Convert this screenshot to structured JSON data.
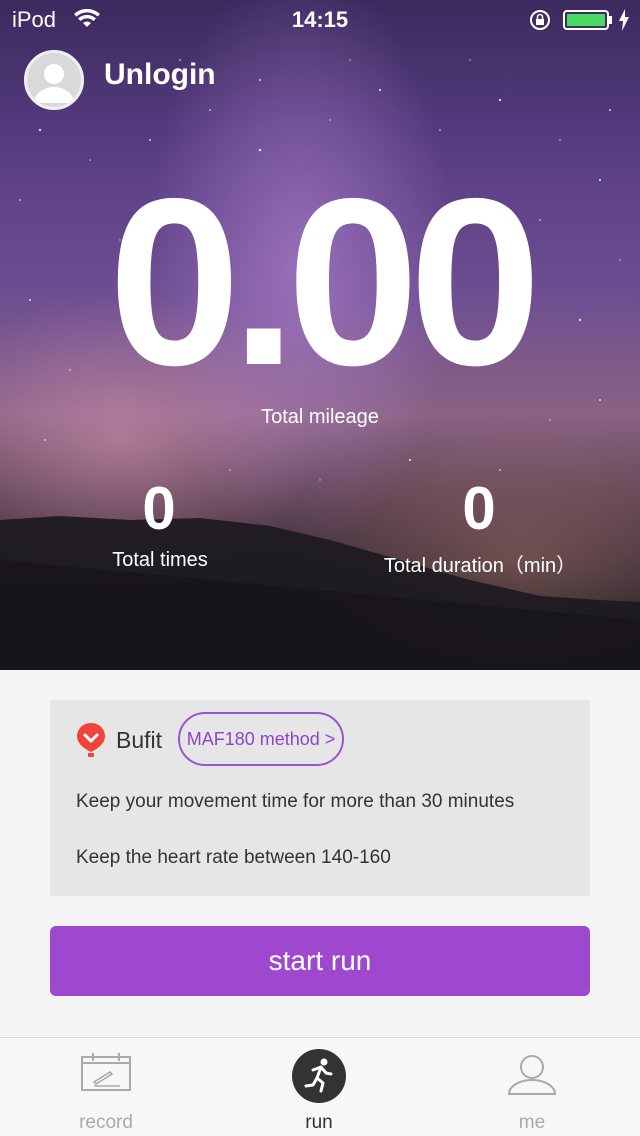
{
  "status_bar": {
    "carrier": "iPod",
    "time": "14:15",
    "icons": [
      "wifi-icon",
      "lock-rotation-icon",
      "battery-icon",
      "charging-icon"
    ],
    "battery_color": "#4cd964"
  },
  "header": {
    "username": "Unlogin",
    "avatar_icon": "user-avatar-icon"
  },
  "stats": {
    "mileage_value": "0.00",
    "mileage_label": "Total mileage",
    "times_value": "0",
    "times_label": "Total times",
    "duration_value": "0",
    "duration_label": "Total duration（min）"
  },
  "info_card": {
    "brand_icon": "balloon-icon",
    "brand_name": "Bufit",
    "method_button": "MAF180 method >",
    "tips": [
      "Keep your movement time for more than 30 minutes",
      "Keep the heart rate between 140-160"
    ]
  },
  "start_button": "start run",
  "tabs": [
    {
      "label": "record",
      "icon": "calendar-edit-icon",
      "active": false
    },
    {
      "label": "run",
      "icon": "running-person-icon",
      "active": true
    },
    {
      "label": "me",
      "icon": "person-icon",
      "active": false
    }
  ],
  "colors": {
    "accent": "#9d48cf",
    "card_bg": "#e6e6e6",
    "page_bg": "#f4f4f4",
    "balloon": "#f0443a"
  }
}
